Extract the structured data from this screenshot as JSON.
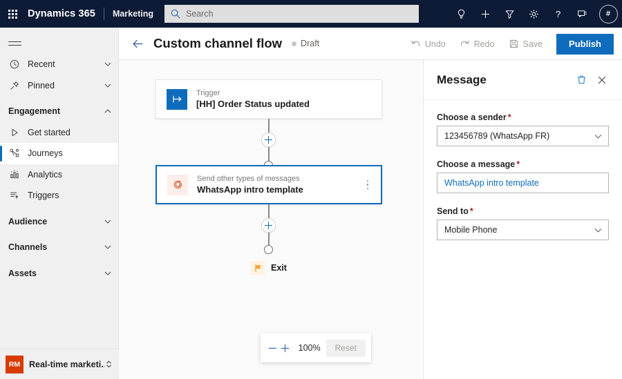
{
  "topbar": {
    "waffle_label": "app-launcher",
    "brand": "Dynamics 365",
    "app_name": "Marketing",
    "search": {
      "placeholder": "Search",
      "value": ""
    },
    "icons": [
      {
        "name": "lightbulb-icon",
        "label": "Insights"
      },
      {
        "name": "plus-icon",
        "label": "Quick create"
      },
      {
        "name": "filter-icon",
        "label": "Filter"
      },
      {
        "name": "gear-icon",
        "label": "Settings"
      },
      {
        "name": "help-icon",
        "label": "Help"
      },
      {
        "name": "feedback-icon",
        "label": "Feedback"
      }
    ],
    "avatar_initials": "#"
  },
  "sidebar": {
    "hamburger_label": "Show / hide navigation",
    "items": [
      {
        "label": "Recent",
        "icon": "clock-icon",
        "type": "expandable",
        "expanded": false
      },
      {
        "label": "Pinned",
        "icon": "pin-icon",
        "type": "expandable",
        "expanded": false
      },
      {
        "label": "Engagement",
        "icon": "",
        "type": "group",
        "expanded": true
      },
      {
        "label": "Get started",
        "icon": "play-icon",
        "type": "link",
        "selected": false
      },
      {
        "label": "Journeys",
        "icon": "journeys-icon",
        "type": "link",
        "selected": true
      },
      {
        "label": "Analytics",
        "icon": "analytics-icon",
        "type": "link",
        "selected": false
      },
      {
        "label": "Triggers",
        "icon": "triggers-icon",
        "type": "link",
        "selected": false
      },
      {
        "label": "Audience",
        "icon": "",
        "type": "group",
        "expanded": false
      },
      {
        "label": "Channels",
        "icon": "",
        "type": "group",
        "expanded": false
      },
      {
        "label": "Assets",
        "icon": "",
        "type": "group",
        "expanded": false
      }
    ],
    "area_switcher": {
      "badge": "RM",
      "badge_color": "#d83b01",
      "label": "Real-time marketi..."
    }
  },
  "commandbar": {
    "back_label": "Back",
    "title": "Custom channel flow",
    "status": "Draft",
    "undo_label": "Undo",
    "redo_label": "Redo",
    "save_label": "Save",
    "publish_label": "Publish",
    "accent_color": "#0f6cbd"
  },
  "canvas": {
    "nodes": [
      {
        "id": "trigger",
        "subtitle": "Trigger",
        "title": "[HH] Order Status updated",
        "icon": "trigger-arrow-icon",
        "icon_bg": "#0f6cbd",
        "selected": false
      },
      {
        "id": "message",
        "subtitle": "Send other types of messages",
        "title": "WhatsApp intro template",
        "icon": "custom-channel-message-icon",
        "icon_bg": "#fdeeea",
        "selected": true
      }
    ],
    "exit": {
      "label": "Exit",
      "icon": "flag-icon",
      "icon_color": "#f2a33c"
    },
    "add_step_label": "Add step",
    "zoom": {
      "zoom_out_label": "Zoom out",
      "zoom_in_label": "Zoom in",
      "level": "100%",
      "reset_label": "Reset"
    }
  },
  "panel": {
    "title": "Message",
    "delete_label": "Delete",
    "close_label": "Close",
    "fields": [
      {
        "label": "Choose a sender",
        "required": true,
        "type": "select",
        "value": "123456789 (WhatsApp FR)"
      },
      {
        "label": "Choose a message",
        "required": true,
        "type": "link",
        "value": "WhatsApp intro template"
      },
      {
        "label": "Send to",
        "required": true,
        "type": "select",
        "value": "Mobile Phone"
      }
    ]
  }
}
